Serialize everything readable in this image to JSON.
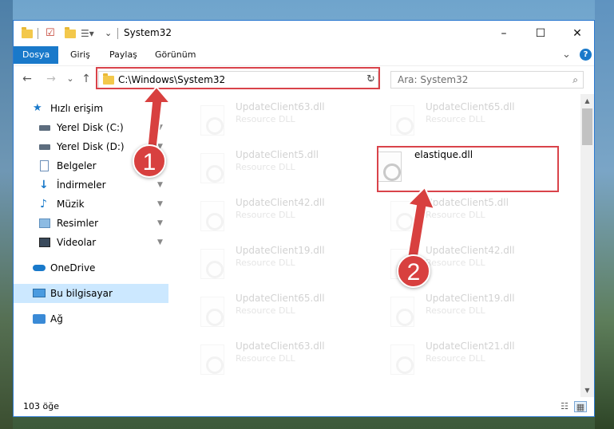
{
  "window": {
    "title": "System32",
    "controls": {
      "minimize": "–",
      "maximize": "☐",
      "close": "✕"
    }
  },
  "ribbon": {
    "tabs": [
      "Dosya",
      "Giriş",
      "Paylaş",
      "Görünüm"
    ],
    "expand_glyph": "⌄",
    "help_glyph": "?"
  },
  "nav": {
    "back": "←",
    "forward": "→",
    "recent": "⌄",
    "up": "↑",
    "address": "C:\\Windows\\System32",
    "address_chevron": "⌄",
    "refresh": "↻",
    "search_placeholder": "Ara: System32",
    "search_icon": "⌕"
  },
  "sidebar": {
    "items": [
      {
        "label": "Hızlı erişim",
        "icon": "star-icon",
        "pinned": false
      },
      {
        "label": "Yerel Disk (C:)",
        "icon": "drive-icon",
        "pinned": true
      },
      {
        "label": "Yerel Disk (D:)",
        "icon": "drive-icon",
        "pinned": true
      },
      {
        "label": "Belgeler",
        "icon": "document-icon",
        "pinned": true
      },
      {
        "label": "İndirmeler",
        "icon": "download-icon",
        "pinned": true
      },
      {
        "label": "Müzik",
        "icon": "music-icon",
        "pinned": true
      },
      {
        "label": "Resimler",
        "icon": "picture-icon",
        "pinned": true
      },
      {
        "label": "Videolar",
        "icon": "video-icon",
        "pinned": true
      },
      {
        "label": "OneDrive",
        "icon": "cloud-icon",
        "pinned": false
      },
      {
        "label": "Bu bilgisayar",
        "icon": "computer-icon",
        "pinned": false,
        "selected": true
      },
      {
        "label": "Ağ",
        "icon": "network-icon",
        "pinned": false
      }
    ],
    "pin_glyph": "📌"
  },
  "files": {
    "left_column": [
      {
        "name": "UpdateClient63.dll",
        "type": "Resource DLL"
      },
      {
        "name": "UpdateClient5.dll",
        "type": "Resource DLL"
      },
      {
        "name": "UpdateClient42.dll",
        "type": "Resource DLL"
      },
      {
        "name": "UpdateClient19.dll",
        "type": "Resource DLL"
      },
      {
        "name": "UpdateClient65.dll",
        "type": "Resource DLL"
      },
      {
        "name": "UpdateClient63.dll",
        "type": "Resource DLL"
      }
    ],
    "right_column": [
      {
        "name": "UpdateClient65.dll",
        "type": "Resource DLL"
      },
      {
        "name": "elastique.dll",
        "type": ""
      },
      {
        "name": "UpdateClient5.dll",
        "type": "Resource DLL"
      },
      {
        "name": "UpdateClient42.dll",
        "type": "Resource DLL"
      },
      {
        "name": "UpdateClient19.dll",
        "type": "Resource DLL"
      },
      {
        "name": "UpdateClient21.dll",
        "type": "Resource DLL"
      }
    ]
  },
  "status": {
    "item_count": "103 öğe"
  },
  "annotations": {
    "step1": "1",
    "step2": "2",
    "highlight_color": "#d9434a",
    "badge_color": "#d8403f"
  },
  "colors": {
    "accent": "#1979ca",
    "selection": "#cce8ff"
  }
}
